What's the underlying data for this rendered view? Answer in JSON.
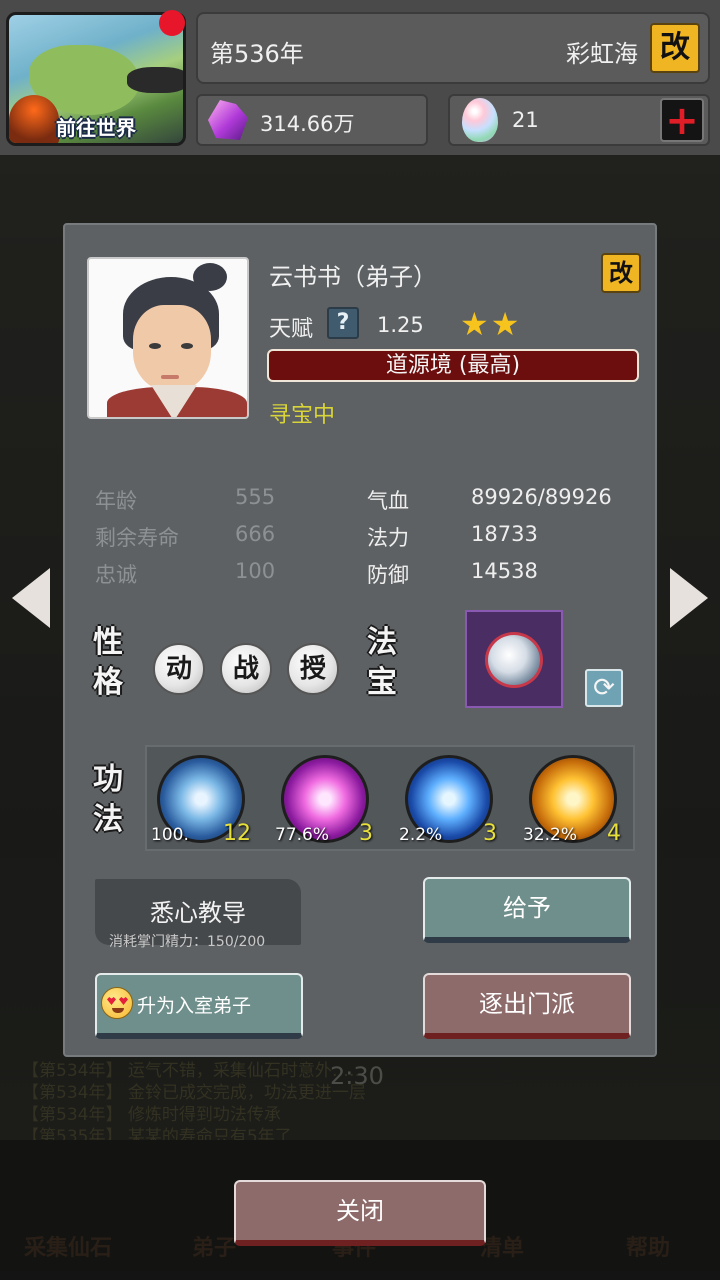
{
  "header": {
    "world_button_label": "前往世界",
    "year": "第536年",
    "location": "彩虹海",
    "rename_label": "改",
    "spirit_stones": "314.66万",
    "eggs": "21",
    "add_label": "+"
  },
  "background": {
    "timer": "2:30",
    "log": [
      "【第534年】 运气不错，采集仙石时意外……",
      "【第534年】 金铃已成交完成，功法更进一层",
      "【第534年】 修炼时得到功法传承",
      "【第535年】 某某的寿命只有5年了"
    ],
    "nav": [
      "采集仙石",
      "弟子",
      "事件",
      "清单",
      "帮助"
    ]
  },
  "dialog": {
    "name": "云书书（弟子）",
    "rename_label": "改",
    "talent_label": "天赋",
    "talent_help": "?",
    "talent_value": "1.25",
    "stars": "★★",
    "realm": "道源境 (最高)",
    "status": "寻宝中",
    "stats_left": [
      {
        "label": "年龄",
        "value": "555"
      },
      {
        "label": "剩余寿命",
        "value": "666"
      },
      {
        "label": "忠诚",
        "value": "100"
      }
    ],
    "stats_right": [
      {
        "label": "气血",
        "value": "89926/89926"
      },
      {
        "label": "法力",
        "value": "18733"
      },
      {
        "label": "防御",
        "value": "14538"
      }
    ],
    "personality_label": [
      "性",
      "格"
    ],
    "traits": [
      "动",
      "战",
      "授"
    ],
    "treasure_label": [
      "法",
      "宝"
    ],
    "technique_label": [
      "功",
      "法"
    ],
    "skills": [
      {
        "pct": "100.",
        "level": "12"
      },
      {
        "pct": "77.6%",
        "level": "3"
      },
      {
        "pct": "2.2%",
        "level": "3"
      },
      {
        "pct": "32.2%",
        "level": "4"
      }
    ],
    "teach_label": "悉心教导",
    "teach_cost": "消耗掌门精力：150/200",
    "give_label": "给予",
    "promote_label": "升为入室弟子",
    "expel_label": "逐出门派"
  },
  "close_label": "关闭"
}
